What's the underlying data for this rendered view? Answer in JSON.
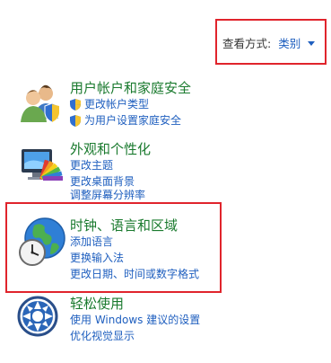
{
  "view_by": {
    "label": "查看方式:",
    "value": "类别"
  },
  "categories": [
    {
      "title": "用户帐户和家庭安全",
      "links": [
        "更改帐户类型",
        "为用户设置家庭安全"
      ]
    },
    {
      "title": "外观和个性化",
      "links": [
        "更改主题",
        "更改桌面背景",
        "调整屏幕分辨率"
      ]
    },
    {
      "title": "时钟、语言和区域",
      "links": [
        "添加语言",
        "更换输入法",
        "更改日期、时间或数字格式"
      ]
    },
    {
      "title": "轻松使用",
      "links": [
        "使用 Windows 建议的设置",
        "优化视觉显示"
      ]
    }
  ],
  "colors": {
    "highlight": "#e0242c",
    "title": "#1a7a2e",
    "link": "#1f5fbf"
  }
}
